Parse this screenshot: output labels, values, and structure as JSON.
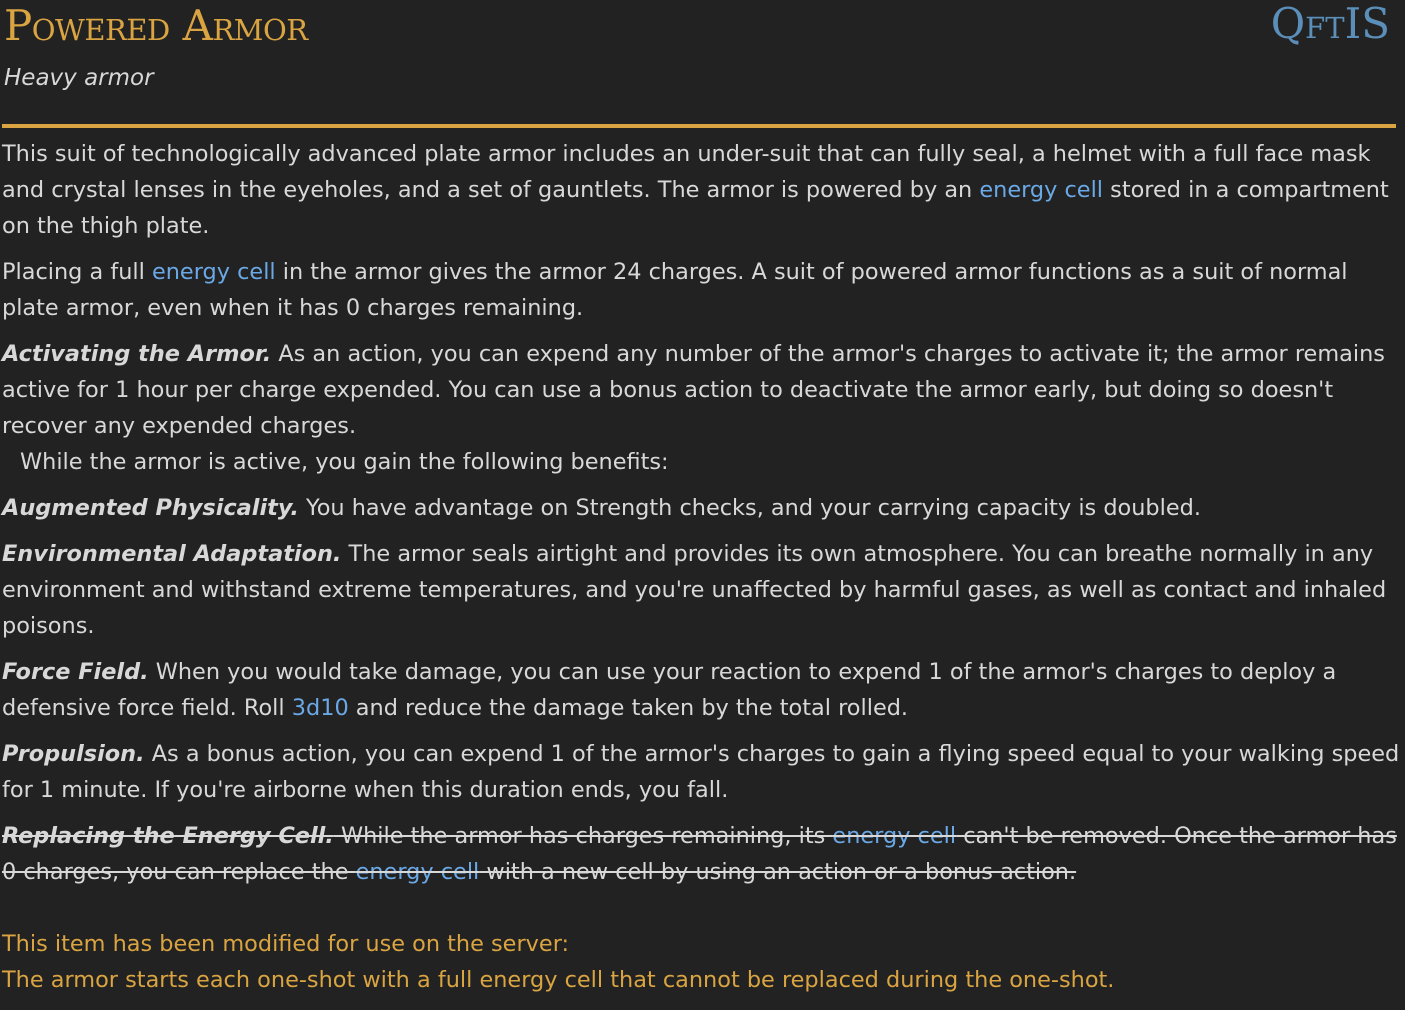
{
  "header": {
    "title": "Powered Armor",
    "source": "QftIS",
    "subtitle": "Heavy armor"
  },
  "body": {
    "p1": {
      "a": "This suit of technologically advanced plate armor includes an under-suit that can fully seal, a helmet with a full face mask and crystal lenses in the eyeholes, and a set of gauntlets. The armor is powered by an ",
      "link": "energy cell",
      "b": " stored in a compartment on the thigh plate."
    },
    "p2": {
      "a": "Placing a full ",
      "link": "energy cell",
      "b": " in the armor gives the armor 24 charges. A suit of powered armor functions as a suit of normal plate armor, even when it has 0 charges remaining."
    },
    "activating": {
      "title": "Activating the Armor.",
      "text": " As an action, you can expend any number of the armor's charges to activate it; the armor remains active for 1 hour per charge expended. You can use a bonus action to deactivate the armor early, but doing so doesn't recover any expended charges.",
      "followup": "While the armor is active, you gain the following benefits:"
    },
    "augmented": {
      "title": "Augmented Physicality.",
      "text": " You have advantage on Strength checks, and your carrying capacity is doubled."
    },
    "environmental": {
      "title": "Environmental Adaptation.",
      "text": " The armor seals airtight and provides its own atmosphere. You can breathe normally in any environment and withstand extreme temperatures, and you're unaffected by harmful gases, as well as contact and inhaled poisons."
    },
    "forcefield": {
      "title": "Force Field.",
      "a": " When you would take damage, you can use your reaction to expend 1 of the armor's charges to deploy a defensive force field. Roll ",
      "dice": "3d10",
      "b": " and reduce the damage taken by the total rolled."
    },
    "propulsion": {
      "title": "Propulsion.",
      "text": " As a bonus action, you can expend 1 of the armor's charges to gain a flying speed equal to your walking speed for 1 minute. If you're airborne when this duration ends, you fall."
    },
    "replacing": {
      "title": "Replacing the Energy Cell.",
      "a": " While the armor has charges remaining, its ",
      "link1": "energy cell",
      "b": " can't be removed. Once the armor has 0 charges, you can replace the ",
      "link2": "energy cell",
      "c": " with a new cell by using an action or a bonus action."
    }
  },
  "modification": {
    "line1": "This item has been modified for use on the server:",
    "line2": "The armor starts each one-shot with a full energy cell that cannot be replaced during the one-shot."
  },
  "colors": {
    "background": "#222222",
    "accent": "#d9a441",
    "link": "#6aa8e6",
    "source": "#5b8fb9",
    "text": "#d8d8d8"
  }
}
